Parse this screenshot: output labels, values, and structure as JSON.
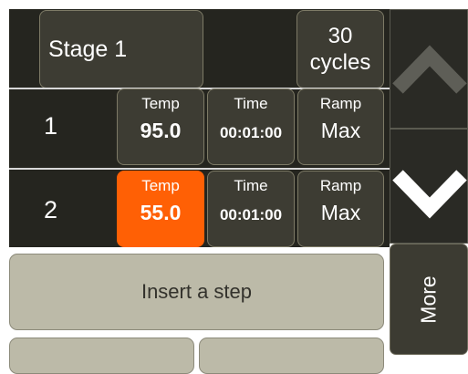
{
  "stage": {
    "label": "Stage 1",
    "cycles_count": "30",
    "cycles_unit": "cycles"
  },
  "steps": [
    {
      "number": "1",
      "temp_label": "Temp",
      "temp_value": "95.0",
      "time_label": "Time",
      "time_value": "00:01:00",
      "ramp_label": "Ramp",
      "ramp_value": "Max"
    },
    {
      "number": "2",
      "temp_label": "Temp",
      "temp_value": "55.0",
      "time_label": "Time",
      "time_value": "00:01:00",
      "ramp_label": "Ramp",
      "ramp_value": "Max"
    }
  ],
  "actions": {
    "insert_step": "Insert a step",
    "more": "More"
  },
  "colors": {
    "selected": "#ff6005",
    "tile": "#3d3c33",
    "button": "#bcbaa8"
  },
  "icons": {
    "scroll_up": "chevron-up-icon",
    "scroll_down": "chevron-down-icon"
  }
}
